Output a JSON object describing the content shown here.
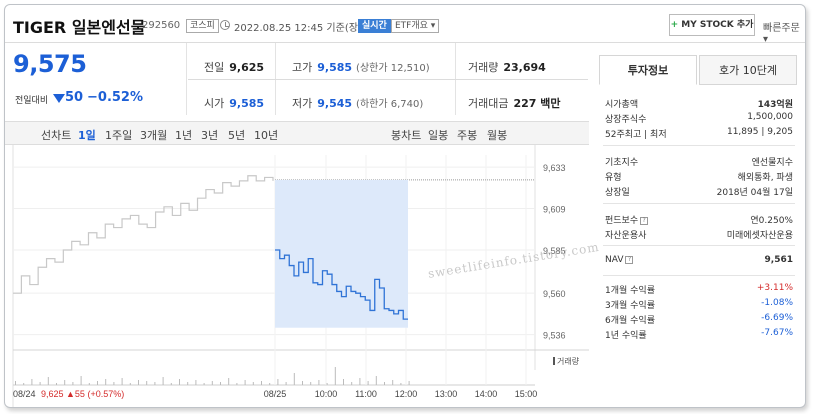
{
  "header": {
    "name": "TIGER 일본엔선물",
    "code": "292560",
    "market_tag": "코스피",
    "timestamp": "2022.08.25 12:45 기준(장중)",
    "live_label": "실시간",
    "etf_label": "ETF개요",
    "mystock_button": "MY STOCK 추가",
    "quick_order": "빠른주문"
  },
  "price": {
    "current": "9,575",
    "change_label": "전일대비",
    "change": "50",
    "change_pct": "−0.52%"
  },
  "stats": {
    "prev_close_label": "전일",
    "prev_close": "9,625",
    "high_label": "고가",
    "high": "9,585",
    "upper_limit": "(상한가 12,510)",
    "volume_label": "거래량",
    "volume": "23,694",
    "open_label": "시가",
    "open": "9,585",
    "low_label": "저가",
    "low": "9,545",
    "lower_limit": "(하한가 6,740)",
    "amount_label": "거래대금",
    "amount": "227 백만"
  },
  "chart_toolbar": {
    "line_chart": "선차트",
    "periods": [
      "1일",
      "1주일",
      "3개월",
      "1년",
      "3년",
      "5년",
      "10년"
    ],
    "selected_period": "1일",
    "candle_chart": "봉차트",
    "candle_periods": [
      "일봉",
      "주봉",
      "월봉"
    ]
  },
  "chart_data": {
    "type": "line",
    "y_ticks": [
      "9,633",
      "9,609",
      "9,585",
      "9,560",
      "9,536"
    ],
    "y_values": [
      9633,
      9609,
      9585,
      9560,
      9536
    ],
    "x_ticks": [
      "08/25",
      "10:00",
      "11:00",
      "12:00",
      "13:00",
      "14:00",
      "15:00"
    ],
    "prev_day_label": "08/24",
    "prev_day_summary": "9,625 ▲55 (+0.57%)",
    "volume_label": "거래량",
    "watermark": "sweetlifeinfo.tistory.com",
    "colors": {
      "prev_line": "#c8c8c8",
      "today_line": "#2f73d6",
      "fill": "#dde9fa"
    },
    "prev_day_series": [
      9560,
      9570,
      9565,
      9575,
      9580,
      9578,
      9585,
      9590,
      9588,
      9595,
      9592,
      9600,
      9598,
      9603,
      9605,
      9600,
      9598,
      9607,
      9610,
      9605,
      9612,
      9608,
      9615,
      9620,
      9618,
      9624,
      9622,
      9625,
      9628,
      9625,
      9627,
      9625
    ],
    "today_series": [
      9585,
      9580,
      9582,
      9576,
      9570,
      9578,
      9572,
      9580,
      9566,
      9565,
      9573,
      9571,
      9565,
      9561,
      9558,
      9564,
      9561,
      9560,
      9558,
      9556,
      9550,
      9568,
      9563,
      9551,
      9550,
      9548,
      9550,
      9545,
      9545
    ],
    "ylim": [
      9530,
      9640
    ]
  },
  "info_panel": {
    "tabs": [
      "투자정보",
      "호가 10단계"
    ],
    "active_tab": "투자정보",
    "rows": [
      {
        "k": "시가총액",
        "v": "143억원",
        "bold": true
      },
      {
        "k": "상장주식수",
        "v": "1,500,000"
      },
      {
        "k": "52주최고 | 최저",
        "v": "11,895 | 9,205"
      },
      {
        "k": "기초지수",
        "v": "엔선물지수"
      },
      {
        "k": "유형",
        "v": "해외통화, 파생"
      },
      {
        "k": "상장일",
        "v": "2018년 04월 17일"
      },
      {
        "k": "펀드보수",
        "v": "연0.250%",
        "q": true
      },
      {
        "k": "자산운용사",
        "v": "미래에셋자산운용"
      },
      {
        "k": "NAV",
        "v": "9,561",
        "bold": true,
        "q": true
      },
      {
        "k": "1개월 수익률",
        "v": "+3.11%",
        "cls": "up"
      },
      {
        "k": "3개월 수익률",
        "v": "-1.08%",
        "cls": "down"
      },
      {
        "k": "6개월 수익률",
        "v": "-6.69%",
        "cls": "down"
      },
      {
        "k": "1년 수익률",
        "v": "-7.67%",
        "cls": "down"
      }
    ]
  }
}
